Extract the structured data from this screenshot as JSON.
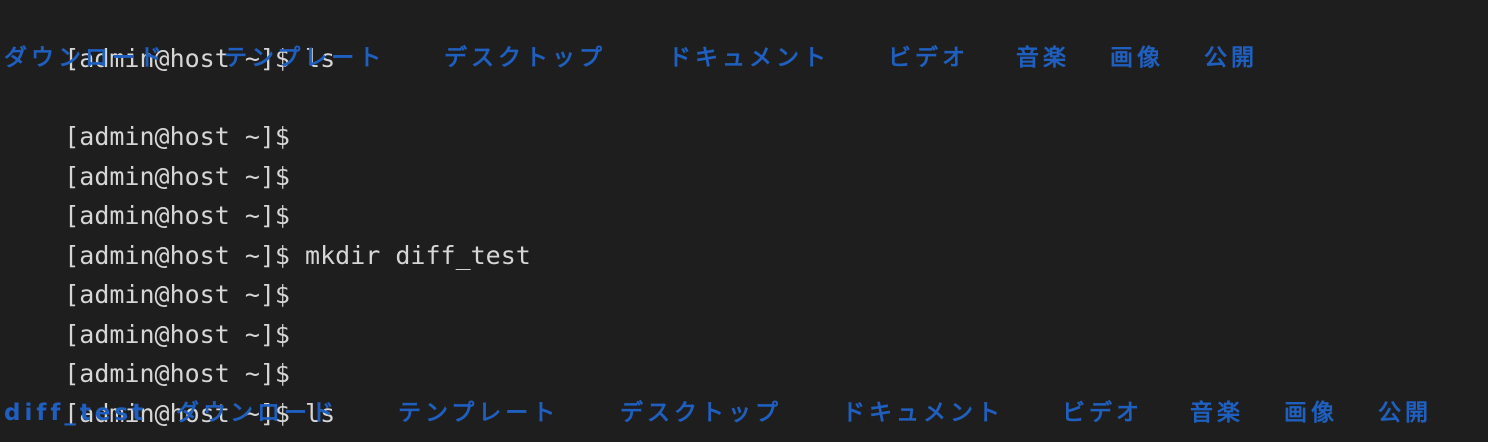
{
  "terminal": {
    "prompt": "[admin@host ~]$",
    "lines": [
      {
        "command": " ls"
      },
      {
        "listing": [
          "ダウンロード",
          "テンプレート",
          "デスクトップ",
          "ドキュメント",
          "ビデオ",
          "音楽",
          "画像",
          "公開"
        ]
      },
      {
        "command": ""
      },
      {
        "command": ""
      },
      {
        "command": ""
      },
      {
        "command": " mkdir diff_test"
      },
      {
        "command": ""
      },
      {
        "command": ""
      },
      {
        "command": ""
      },
      {
        "command": " ls"
      },
      {
        "listing": [
          "diff_test",
          "ダウンロード",
          "テンプレート",
          "デスクトップ",
          "ドキュメント",
          "ビデオ",
          "音楽",
          "画像",
          "公開"
        ]
      }
    ]
  },
  "colors": {
    "background": "#1e1e1e",
    "text": "#d6d6d6",
    "directory": "#1f5fbf"
  }
}
